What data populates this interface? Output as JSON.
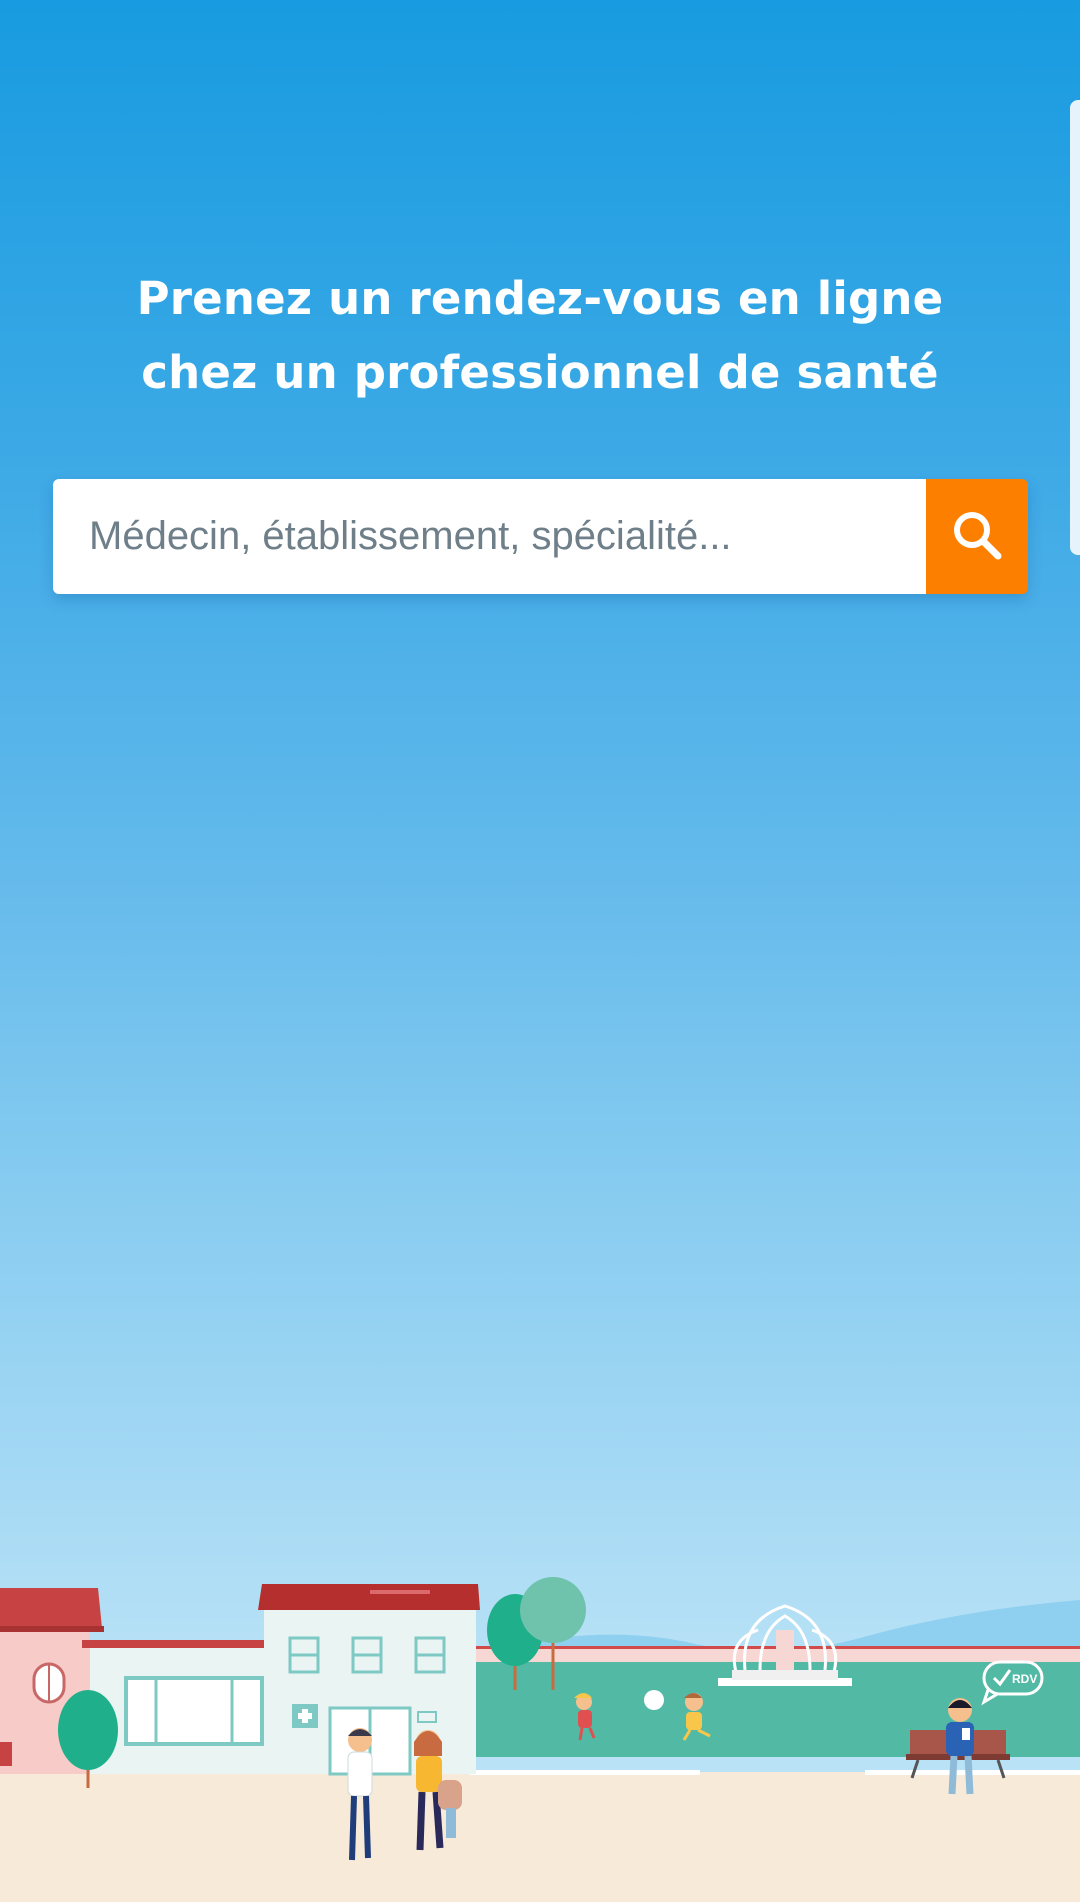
{
  "hero": {
    "headline_line1": "Prenez un rendez-vous en ligne",
    "headline_line2": "chez un professionnel de santé"
  },
  "search": {
    "placeholder": "Médecin, établissement, spécialité...",
    "value": "",
    "button_icon": "search-icon"
  },
  "illustration": {
    "speech_bubble_text": "RDV"
  },
  "colors": {
    "background_top": "#189be0",
    "background_bottom": "#b9e2f6",
    "search_button": "#fd7f00",
    "ground": "#f7ead9",
    "lawn": "#52b9a5"
  }
}
